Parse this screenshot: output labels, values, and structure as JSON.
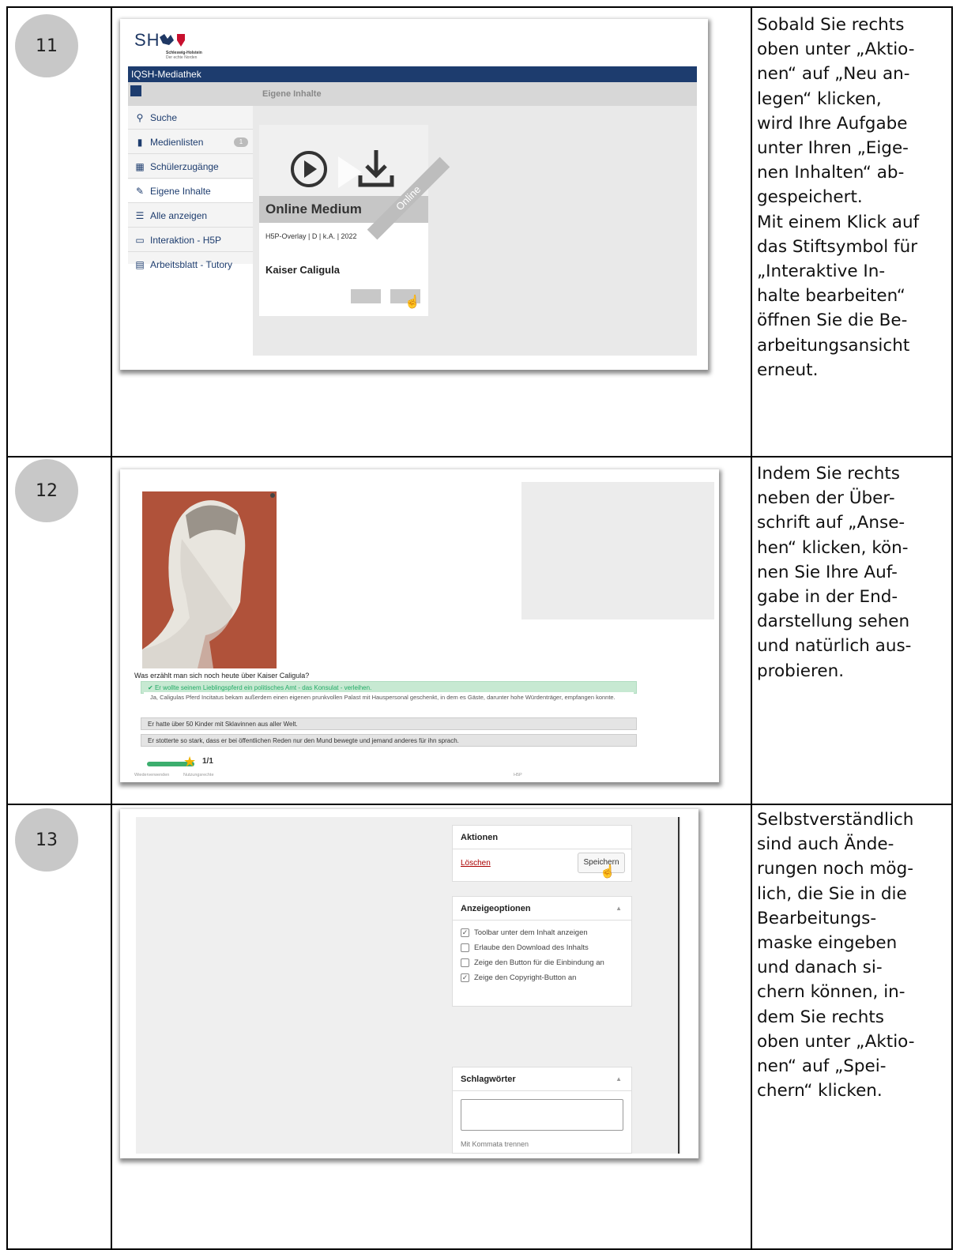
{
  "rows": [
    {
      "number": "11",
      "text_lines": [
        "Sobald Sie rechts",
        "oben unter „Aktio-",
        "nen“ auf „Neu an-",
        "legen“ klicken,",
        "wird Ihre Aufgabe",
        "unter  Ihren „Eige-",
        "nen Inhalten“ ab-",
        "gespeichert.",
        "Mit einem Klick auf",
        "das Stiftsymbol für",
        "„Interaktive In-",
        "halte bearbeiten“",
        "öffnen Sie die Be-",
        "arbeitungsansicht",
        "erneut."
      ]
    },
    {
      "number": "12",
      "text_lines": [
        "Indem Sie rechts",
        "neben der Über-",
        "schrift auf „Anse-",
        "hen“ klicken, kön-",
        "nen Sie Ihre Auf-",
        "gabe in der End-",
        "darstellung sehen",
        "und natürlich aus-",
        "probieren."
      ]
    },
    {
      "number": "13",
      "text_lines": [
        "Selbstverständlich",
        "sind auch Ände-",
        "rungen noch mög-",
        "lich, die Sie in die",
        "Bearbeitungs-",
        "maske eingeben",
        "und danach si-",
        "chern können, in-",
        "dem Sie rechts",
        "oben unter „Aktio-",
        "nen“ auf „Spei-",
        "chern“ klicken."
      ]
    }
  ],
  "shot11": {
    "logo": "SH",
    "logo_sub1": "Schleswig-Holstein",
    "logo_sub2": "Der echte Norden",
    "app_title": "IQSH-Mediathek",
    "breadcrumb": "Eigene Inhalte",
    "sidebar": [
      {
        "label": "Suche",
        "icon": "search-icon"
      },
      {
        "label": "Medienlisten",
        "icon": "bookmark-icon",
        "badge": "1"
      },
      {
        "label": "Schülerzugänge",
        "icon": "grid-icon"
      },
      {
        "label": "Eigene Inhalte",
        "icon": "edit-icon"
      },
      {
        "label": "Alle anzeigen",
        "icon": "list-icon"
      },
      {
        "label": "Interaktion - H5P",
        "icon": "monitor-icon"
      },
      {
        "label": "Arbeitsblatt - Tutory",
        "icon": "document-icon"
      }
    ],
    "card": {
      "title": "Online Medium",
      "ribbon": "Online",
      "meta": "H5P-Overlay | D | k.A. | 2022",
      "name": "Kaiser Caligula"
    }
  },
  "shot12": {
    "question": "Was erzählt man sich noch heute über Kaiser Caligula?",
    "answers": [
      "Er wollte seinem Lieblingspferd ein politisches Amt - das Konsulat - verleihen.",
      "Er hatte über 50 Kinder mit Sklavinnen aus aller Welt.",
      "Er stotterte so stark, dass er bei öffentlichen Reden nur den Mund bewegte und jemand anderes für ihn sprach."
    ],
    "explanation": "Ja, Caligulas Pferd Incitatus bekam außerdem einen eigenen prunkvollen Palast mit Hauspersonal geschenkt, in dem es Gäste, darunter hohe Würdenträger, empfangen konnte.",
    "score": "1/1",
    "footer_reuse": "Wiederverwenden",
    "footer_rights": "Nutzungsrechte",
    "footer_h5p": "H5P"
  },
  "shot13": {
    "actions_title": "Aktionen",
    "delete": "Löschen",
    "save": "Speichern",
    "display_title": "Anzeigeoptionen",
    "options": [
      {
        "label": "Toolbar unter dem Inhalt anzeigen",
        "checked": true
      },
      {
        "label": "Erlaube den Download des Inhalts",
        "checked": false
      },
      {
        "label": "Zeige den Button für die Einbindung an",
        "checked": false
      },
      {
        "label": "Zeige den Copyright-Button an",
        "checked": true
      }
    ],
    "tags_title": "Schlagwörter",
    "tags_hint": "Mit Kommata trennen"
  }
}
